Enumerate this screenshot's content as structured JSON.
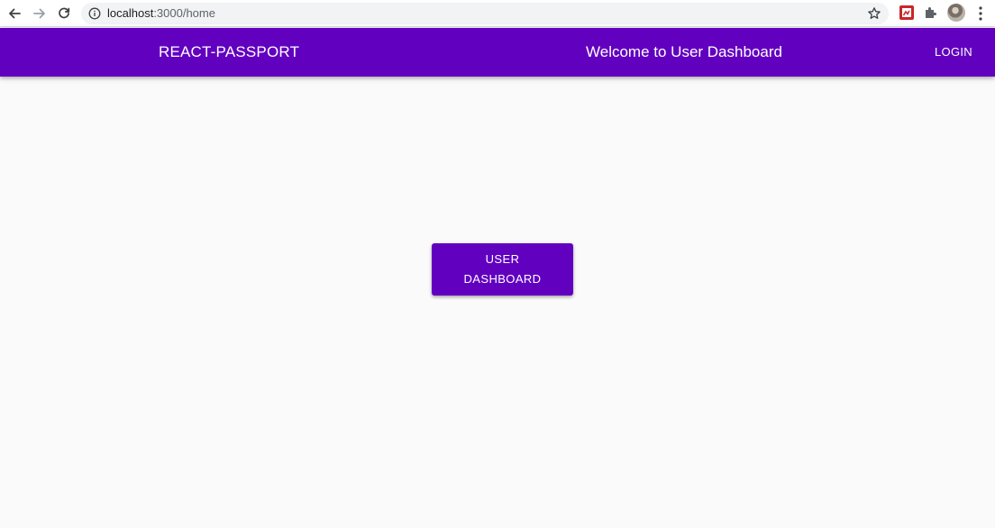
{
  "browser": {
    "url_host": "localhost",
    "url_path": ":3000/home",
    "icons": [
      "back-arrow-icon",
      "forward-arrow-icon",
      "reload-icon",
      "site-info-icon",
      "bookmark-star-icon",
      "extension-icon",
      "puzzle-extensions-icon",
      "profile-avatar",
      "more-menu-icon"
    ]
  },
  "app_bar": {
    "brand": "REACT-PASSPORT",
    "title": "Welcome to User Dashboard",
    "login_label": "LOGIN",
    "color": "#6200c0"
  },
  "main": {
    "dashboard_button_line1": "USER",
    "dashboard_button_line2": "DASHBOARD"
  },
  "colors": {
    "primary": "#6200c0",
    "background": "#fafafa",
    "text_on_primary": "#ffffff"
  }
}
